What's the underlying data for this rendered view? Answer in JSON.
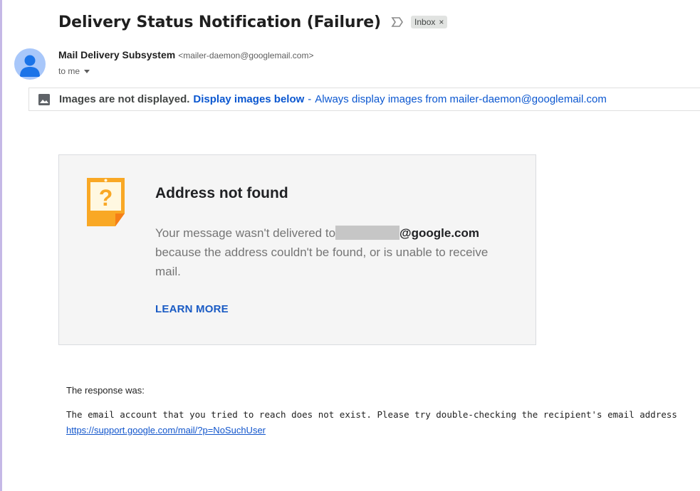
{
  "email": {
    "subject": "Delivery Status Notification (Failure)",
    "label_chip": "Inbox",
    "label_chip_close": "×",
    "sender_name": "Mail Delivery Subsystem",
    "sender_email": "<mailer-daemon@googlemail.com>",
    "to_text": "to me"
  },
  "images_bar": {
    "text": "Images are not displayed.",
    "display_link": "Display images below",
    "separator": "-",
    "always_link": "Always display images from mailer-daemon@googlemail.com"
  },
  "card": {
    "title": "Address not found",
    "body_prefix": "Your message wasn't delivered to",
    "body_domain": "@google.com",
    "body_suffix": "because the address couldn't be found, or is unable to receive mail.",
    "learn_more": "LEARN MORE"
  },
  "response": {
    "label": "The response was:",
    "text": "The email account that you tried to reach does not exist. Please try double-checking the recipient's email address",
    "link": "https://support.google.com/mail/?p=NoSuchUser"
  },
  "icons": {
    "importance": "importance-marker-icon",
    "image": "image-placeholder-icon",
    "question": "question-note-icon",
    "avatar": "default-avatar-icon"
  },
  "colors": {
    "link": "#0b57d0",
    "card_bg": "#f5f5f5",
    "note_orange": "#f9a825",
    "avatar_bg": "#a8c7fa",
    "avatar_fg": "#1a73e8"
  }
}
